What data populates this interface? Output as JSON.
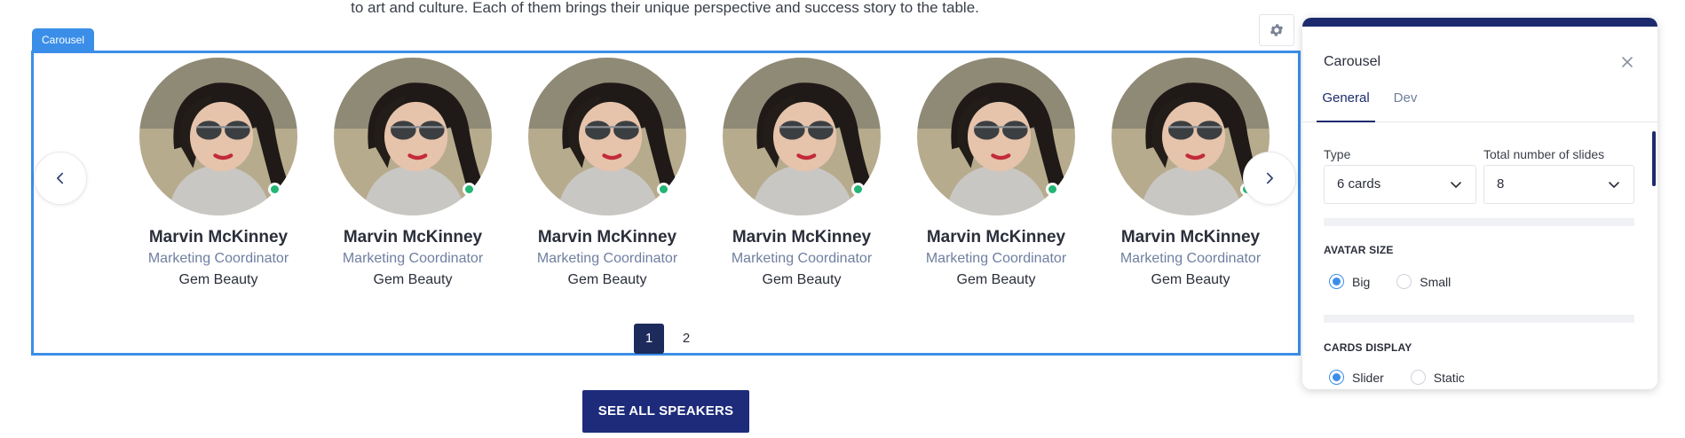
{
  "intro": {
    "text": "to art and culture. Each of them brings their unique perspective and success story to the table."
  },
  "carousel": {
    "tag_label": "Carousel",
    "cards": [
      {
        "name": "Marvin McKinney",
        "role": "Marketing Coordinator",
        "company": "Gem Beauty"
      },
      {
        "name": "Marvin McKinney",
        "role": "Marketing Coordinator",
        "company": "Gem Beauty"
      },
      {
        "name": "Marvin McKinney",
        "role": "Marketing Coordinator",
        "company": "Gem Beauty"
      },
      {
        "name": "Marvin McKinney",
        "role": "Marketing Coordinator",
        "company": "Gem Beauty"
      },
      {
        "name": "Marvin McKinney",
        "role": "Marketing Coordinator",
        "company": "Gem Beauty"
      },
      {
        "name": "Marvin McKinney",
        "role": "Marketing Coordinator",
        "company": "Gem Beauty"
      }
    ],
    "pages": [
      "1",
      "2"
    ],
    "active_page": "1",
    "prev_icon": "chevron-left-icon",
    "next_icon": "chevron-right-icon"
  },
  "cta": {
    "see_all_label": "SEE ALL SPEAKERS"
  },
  "settings_icon": "gear-icon",
  "panel": {
    "title": "Carousel",
    "close_icon": "close-icon",
    "tabs": [
      {
        "label": "General",
        "active": true
      },
      {
        "label": "Dev",
        "active": false
      }
    ],
    "type": {
      "label": "Type",
      "value": "6 cards"
    },
    "total_slides": {
      "label": "Total number of slides",
      "value": "8"
    },
    "avatar_size": {
      "title": "AVATAR SIZE",
      "options": [
        {
          "label": "Big",
          "checked": true
        },
        {
          "label": "Small",
          "checked": false
        }
      ]
    },
    "cards_display": {
      "title": "CARDS DISPLAY",
      "options": [
        {
          "label": "Slider",
          "checked": true
        },
        {
          "label": "Static",
          "checked": false
        }
      ]
    }
  },
  "colors": {
    "accent_blue": "#3b8ee8",
    "navy": "#1d2b6e",
    "button_navy": "#1d2b7a",
    "status_green": "#22b573",
    "role_text": "#6f7fa0"
  }
}
